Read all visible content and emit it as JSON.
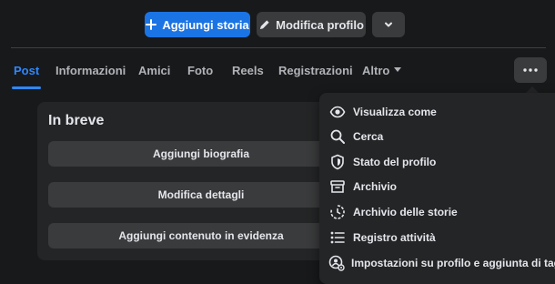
{
  "header": {
    "add_story_label": "Aggiungi storia",
    "edit_profile_label": "Modifica profilo"
  },
  "tabs": [
    {
      "label": "Post"
    },
    {
      "label": "Informazioni"
    },
    {
      "label": "Amici"
    },
    {
      "label": "Foto"
    },
    {
      "label": "Reels"
    },
    {
      "label": "Registrazioni"
    },
    {
      "label": "Altro"
    }
  ],
  "intro": {
    "title": "In breve",
    "buttons": [
      {
        "label": "Aggiungi biografia"
      },
      {
        "label": "Modifica dettagli"
      },
      {
        "label": "Aggiungi contenuto in evidenza"
      }
    ]
  },
  "menu": {
    "items": [
      {
        "label": "Visualizza come",
        "icon": "eye-icon"
      },
      {
        "label": "Cerca",
        "icon": "search-icon"
      },
      {
        "label": "Stato del profilo",
        "icon": "shield-icon"
      },
      {
        "label": "Archivio",
        "icon": "archive-icon"
      },
      {
        "label": "Archivio delle storie",
        "icon": "story-archive-icon"
      },
      {
        "label": "Registro attività",
        "icon": "list-icon"
      },
      {
        "label": "Impostazioni su profilo e aggiunta di tag",
        "icon": "profile-settings-icon"
      }
    ]
  },
  "colors": {
    "accent": "#1b74e4",
    "active_tab": "#2d88ff",
    "background": "#18191a",
    "surface": "#242526",
    "button": "#3a3b3c"
  }
}
